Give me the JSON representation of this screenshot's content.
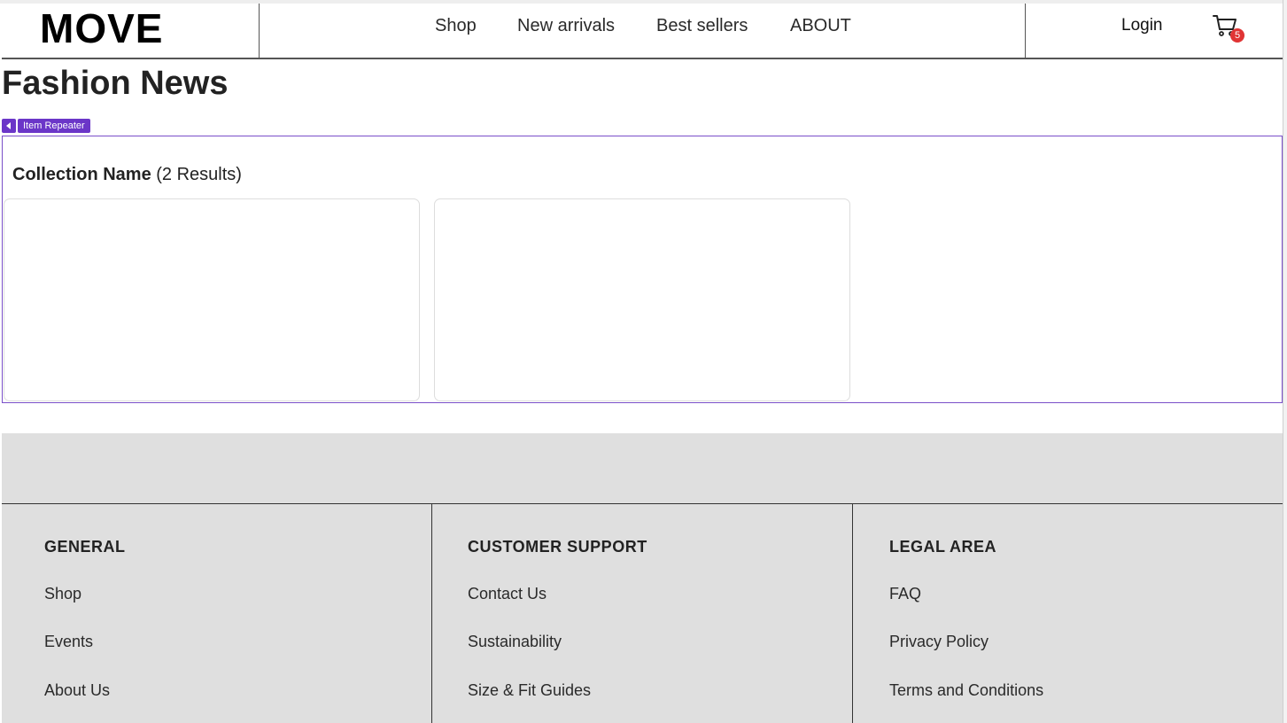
{
  "header": {
    "logo": "MOVE",
    "nav": [
      {
        "label": "Shop"
      },
      {
        "label": "New arrivals"
      },
      {
        "label": "Best sellers"
      },
      {
        "label": "ABOUT"
      }
    ],
    "login_label": "Login",
    "cart_count": "5"
  },
  "page": {
    "title": "Fashion News"
  },
  "repeater": {
    "tag_label": "Item Repeater",
    "collection_name": "Collection Name",
    "results_text": "(2 Results)"
  },
  "footer": {
    "columns": [
      {
        "title": "GENERAL",
        "links": [
          "Shop",
          "Events",
          "About Us"
        ]
      },
      {
        "title": "CUSTOMER SUPPORT",
        "links": [
          "Contact Us",
          "Sustainability",
          "Size & Fit Guides"
        ]
      },
      {
        "title": "LEGAL AREA",
        "links": [
          "FAQ",
          "Privacy Policy",
          "Terms and Conditions"
        ]
      }
    ]
  },
  "colors": {
    "accent": "#6b36c8",
    "badge": "#e03434",
    "footer_bg": "#dfdfdf"
  }
}
